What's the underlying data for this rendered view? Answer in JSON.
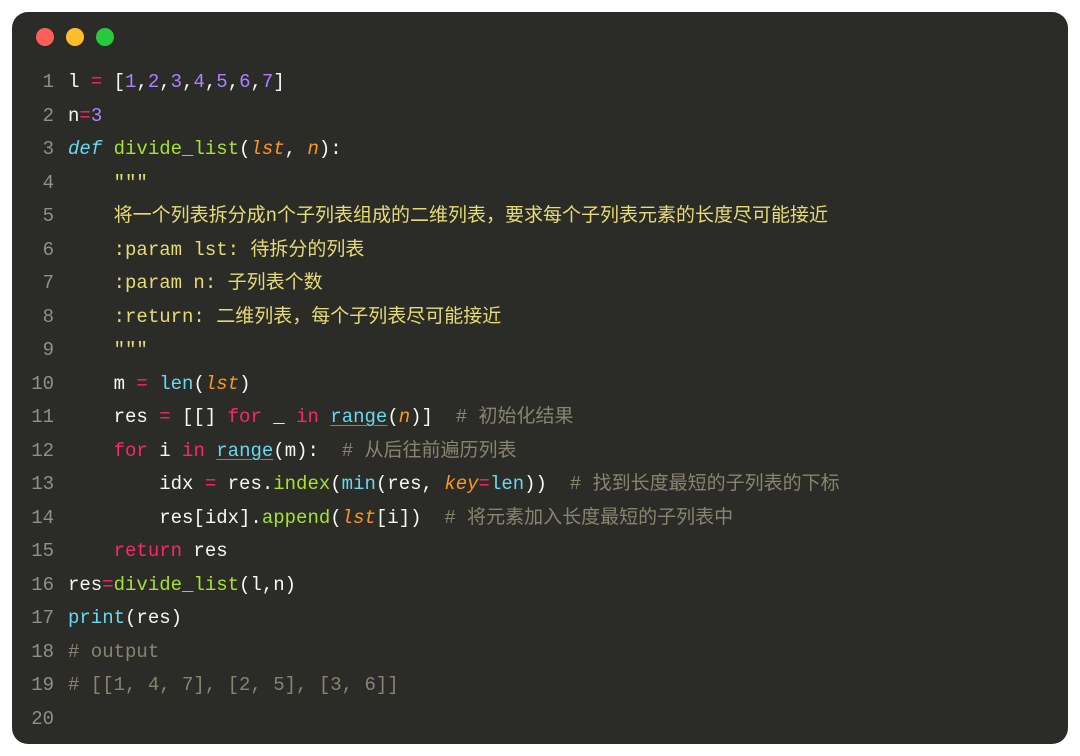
{
  "window": {
    "dots": [
      "red",
      "yellow",
      "green"
    ]
  },
  "gutter": {
    "start": 1,
    "end": 20
  },
  "code": {
    "line1": {
      "a": "l ",
      "b": "=",
      "c": " [",
      "nums": [
        "1",
        "2",
        "3",
        "4",
        "5",
        "6",
        "7"
      ],
      "comma": ",",
      "d": "]"
    },
    "line2": {
      "a": "n",
      "b": "=",
      "c": "3"
    },
    "line3": {
      "def": "def",
      "sp": " ",
      "name": "divide_list",
      "open": "(",
      "arg1": "lst",
      "cm": ", ",
      "arg2": "n",
      "close": "):"
    },
    "line4": {
      "indent": "    ",
      "q": "\"\"\""
    },
    "line5": {
      "indent": "    ",
      "txt": "将一个列表拆分成n个子列表组成的二维列表，要求每个子列表元素的长度尽可能接近"
    },
    "line6": {
      "indent": "    ",
      "txt": ":param lst: 待拆分的列表"
    },
    "line7": {
      "indent": "    ",
      "txt": ":param n: 子列表个数"
    },
    "line8": {
      "indent": "    ",
      "txt": ":return: 二维列表，每个子列表尽可能接近"
    },
    "line9": {
      "indent": "    ",
      "q": "\"\"\""
    },
    "line10": {
      "indent": "    ",
      "a": "m ",
      "eq": "=",
      "sp": " ",
      "len": "len",
      "open": "(",
      "arg": "lst",
      "close": ")"
    },
    "line11": {
      "indent": "    ",
      "a": "res ",
      "eq": "=",
      "b": " [[] ",
      "for": "for",
      "c": " _ ",
      "in": "in",
      "d": " ",
      "range": "range",
      "open": "(",
      "arg": "n",
      "close": ")]  ",
      "com": "# 初始化结果"
    },
    "line12": {
      "indent": "    ",
      "for": "for",
      "a": " i ",
      "in": "in",
      "b": " ",
      "range": "range",
      "open": "(",
      "arg": "m",
      "close": "):  ",
      "com": "# 从后往前遍历列表"
    },
    "line13": {
      "indent": "        ",
      "a": "idx ",
      "eq": "=",
      "b": " res.",
      "index": "index",
      "open": "(",
      "min": "min",
      "open2": "(",
      "c": "res, ",
      "key": "key",
      "eq2": "=",
      "len": "len",
      "close": "))  ",
      "com": "# 找到长度最短的子列表的下标"
    },
    "line14": {
      "indent": "        ",
      "a": "res[idx].",
      "append": "append",
      "open": "(",
      "arg": "lst",
      "b": "[i])  ",
      "com": "# 将元素加入长度最短的子列表中"
    },
    "line15": {
      "indent": "    ",
      "ret": "return",
      "a": " res"
    },
    "line16": {
      "a": "res",
      "eq": "=",
      "fn": "divide_list",
      "open": "(",
      "arg1": "l",
      "cm": ",",
      "arg2": "n",
      "close": ")"
    },
    "line17": {
      "print": "print",
      "open": "(",
      "a": "res",
      "close": ")"
    },
    "line18": {
      "blank": ""
    },
    "line19": {
      "com": "# output"
    },
    "line20": {
      "com": "# [[1, 4, 7], [2, 5], [3, 6]]"
    }
  }
}
